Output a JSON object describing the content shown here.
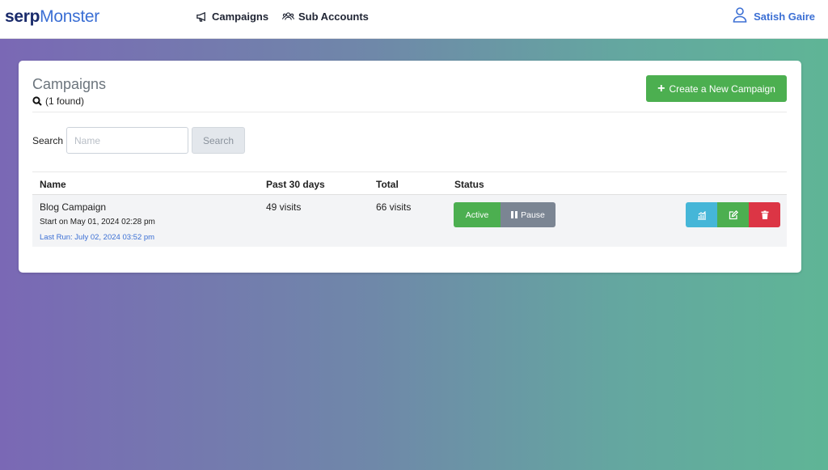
{
  "app": {
    "brand_bold": "serp",
    "brand_light": "Monster"
  },
  "nav": {
    "campaigns_label": "Campaigns",
    "sub_accounts_label": "Sub Accounts",
    "user_name": "Satish Gaire"
  },
  "page": {
    "title": "Campaigns",
    "found_text": "(1 found)",
    "create_button": "Create a New Campaign",
    "create_plus": "+"
  },
  "search": {
    "label": "Search",
    "placeholder": "Name",
    "value": "",
    "button": "Search"
  },
  "table": {
    "headers": {
      "name": "Name",
      "past30": "Past 30 days",
      "total": "Total",
      "status": "Status"
    },
    "rows": [
      {
        "name": "Blog Campaign",
        "start": "Start on May 01, 2024 02:28 pm",
        "last_run": "Last Run: July 02, 2024 03:52 pm",
        "past30": "49 visits",
        "total": "66 visits",
        "status_active": "Active",
        "status_pause": "Pause"
      }
    ]
  },
  "icons": {
    "campaigns": "megaphone-icon",
    "sub_accounts": "users-icon",
    "user": "user-icon",
    "found": "search-icon",
    "stats": "chart-icon",
    "edit": "edit-icon",
    "delete": "trash-icon"
  },
  "colors": {
    "brand_dark": "#1a2b6b",
    "brand_blue": "#3b6fd4",
    "success": "#4caf50",
    "secondary": "#7b8593",
    "info": "#45b6d8",
    "danger": "#dc3545",
    "gradient_start": "#7a68b5",
    "gradient_end": "#5fb596"
  }
}
